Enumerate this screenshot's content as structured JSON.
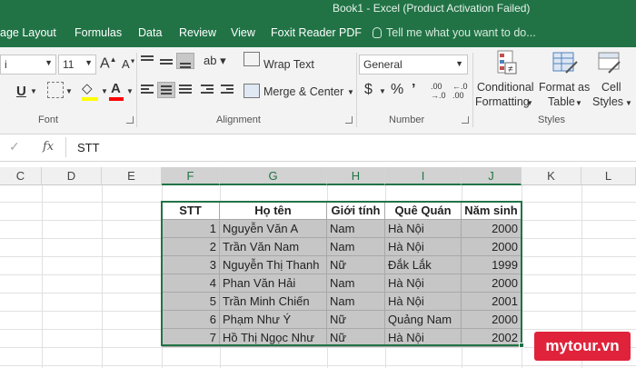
{
  "window": {
    "title": "Book1 - Excel (Product Activation Failed)"
  },
  "menu": [
    "age Layout",
    "Formulas",
    "Data",
    "Review",
    "View",
    "Foxit Reader PDF"
  ],
  "tell_me": "Tell me what you want to do...",
  "ribbon": {
    "font": {
      "size": "11",
      "group_label": "Font"
    },
    "alignment": {
      "wrap_text": "Wrap Text",
      "merge_center": "Merge & Center",
      "group_label": "Alignment"
    },
    "number": {
      "format": "General",
      "dollar": "$",
      "percent": "%",
      "comma": "’",
      "increase_decimal": ".00 →.0",
      "decrease_decimal": "←.0 .00",
      "group_label": "Number"
    },
    "styles": {
      "conditional_formatting": [
        "Conditional",
        "Formatting"
      ],
      "format_as_table": [
        "Format as",
        "Table"
      ],
      "cell_styles": [
        "Cell",
        "Styles"
      ],
      "group_label": "Styles"
    },
    "colors": {
      "accent": "#217346",
      "highlight": "#ffff00",
      "font_color": "#ff0000"
    }
  },
  "formula_bar": {
    "fx": "fx",
    "value": "STT"
  },
  "columns": [
    "C",
    "D",
    "E",
    "F",
    "G",
    "H",
    "I",
    "J",
    "K",
    "L"
  ],
  "table": {
    "headers": [
      "STT",
      "Họ tên",
      "Giới tính",
      "Quê Quán",
      "Năm sinh"
    ],
    "rows": [
      [
        "1",
        "Nguyễn Văn A",
        "Nam",
        "Hà Nội",
        "2000"
      ],
      [
        "2",
        "Trần Văn Nam",
        "Nam",
        "Hà Nội",
        "2000"
      ],
      [
        "3",
        "Nguyễn Thị Thanh",
        "Nữ",
        "Đắk Lắk",
        "1999"
      ],
      [
        "4",
        "Phan Văn Hải",
        "Nam",
        "Hà Nội",
        "2000"
      ],
      [
        "5",
        "Trần Minh Chiến",
        "Nam",
        "Hà Nội",
        "2001"
      ],
      [
        "6",
        "Phạm Như Ý",
        "Nữ",
        "Quảng Nam",
        "2000"
      ],
      [
        "7",
        "Hồ Thị Ngọc Như",
        "Nữ",
        "Hà Nội",
        "2002"
      ]
    ]
  },
  "watermark": "mytour.vn"
}
